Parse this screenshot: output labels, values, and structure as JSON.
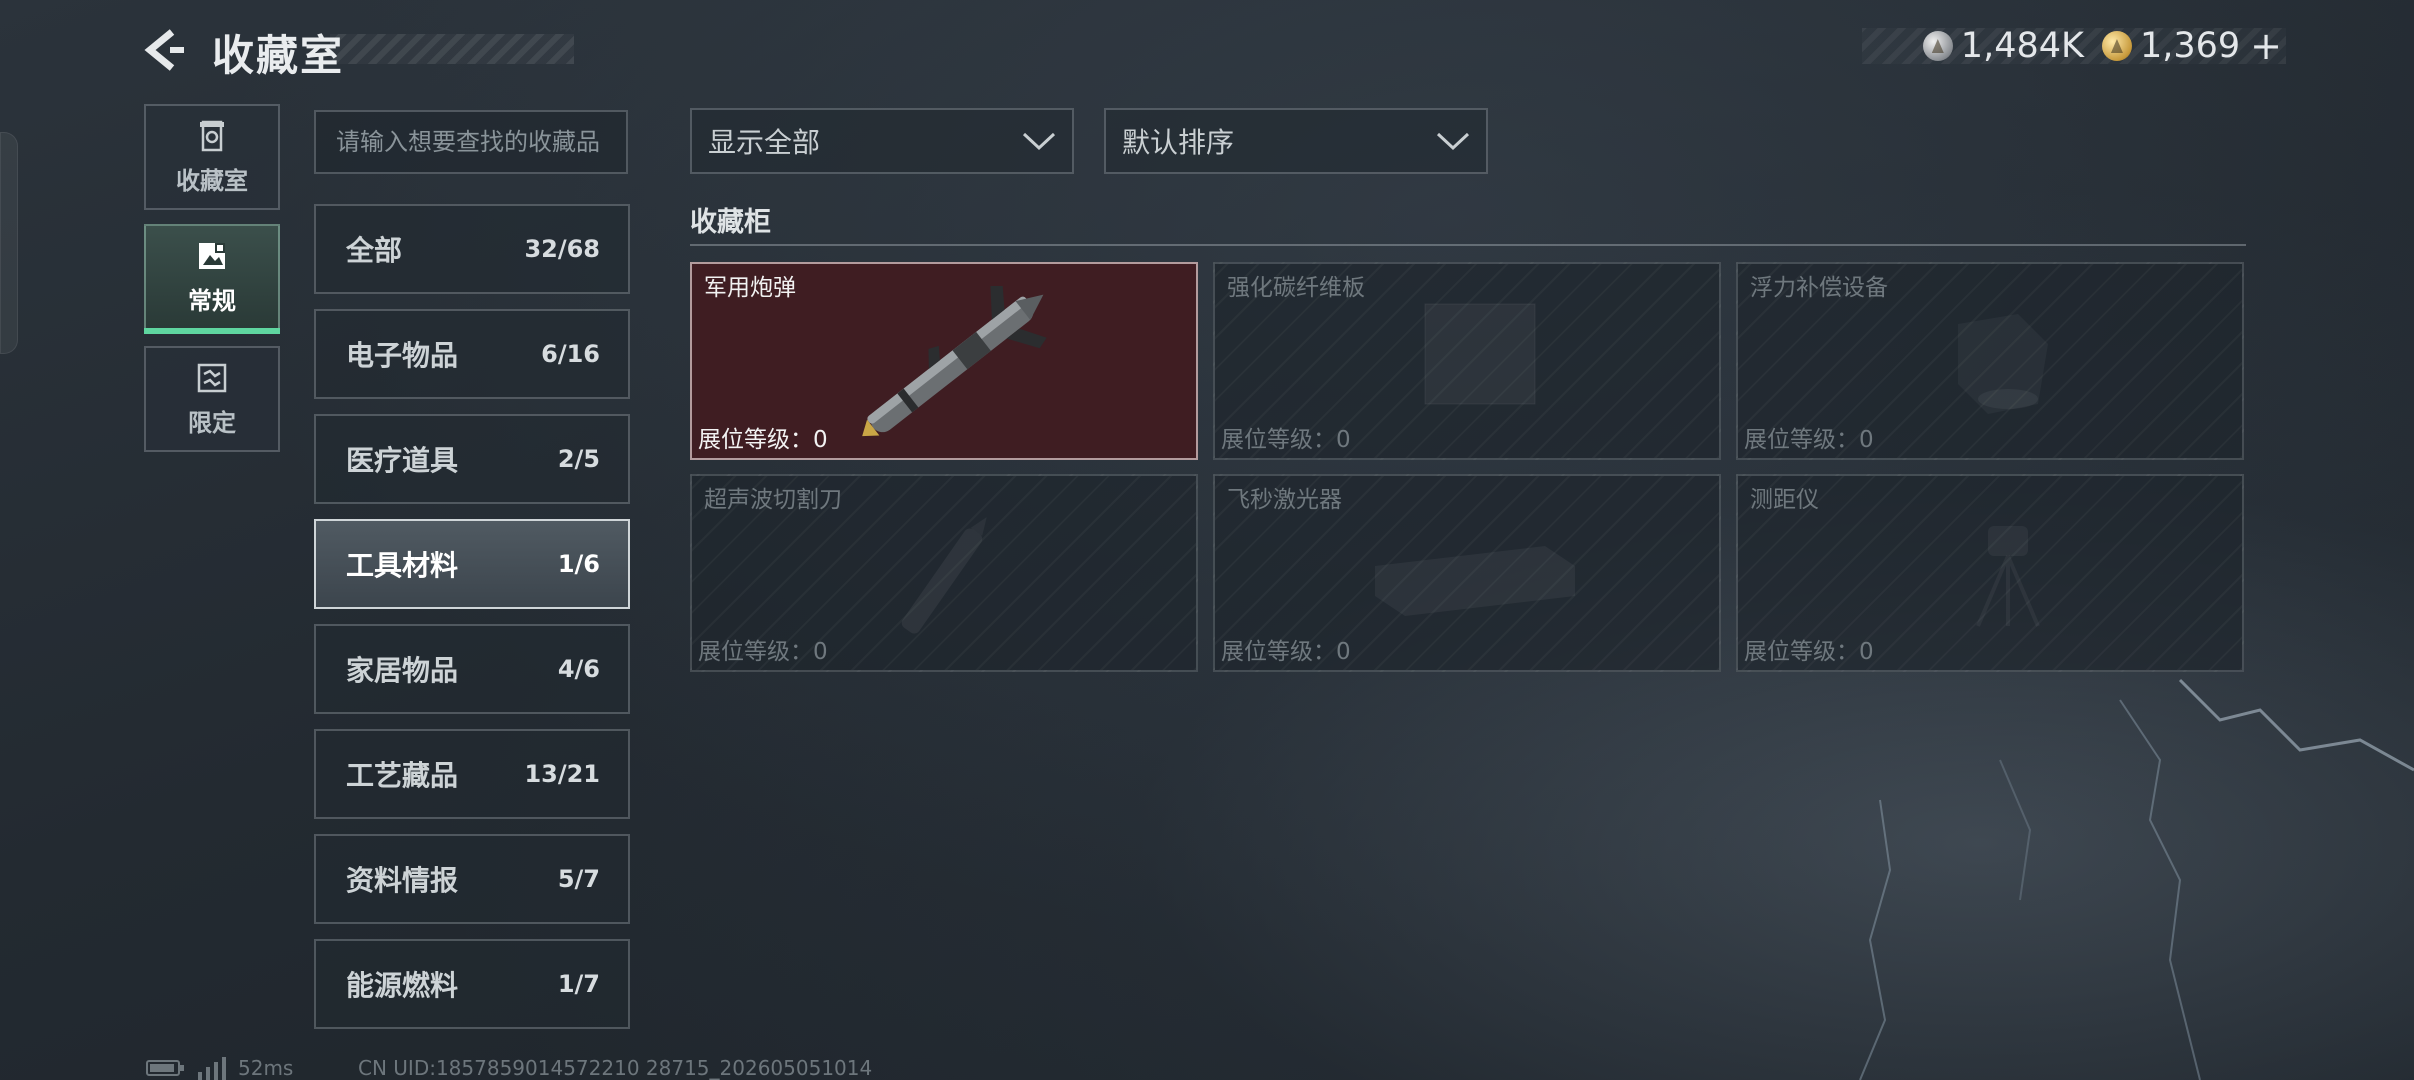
{
  "header": {
    "title": "收藏室",
    "currencies": [
      {
        "icon": "silver-coin-icon",
        "value": "1,484K"
      },
      {
        "icon": "gold-coin-icon",
        "value": "1,369"
      }
    ],
    "add_label": "+"
  },
  "side_nav": [
    {
      "label": "收藏室",
      "icon": "collection-room-icon",
      "active": false
    },
    {
      "label": "常规",
      "icon": "regular-icon",
      "active": true
    },
    {
      "label": "限定",
      "icon": "limited-icon",
      "active": false
    }
  ],
  "search": {
    "placeholder": "请输入想要查找的收藏品",
    "value": ""
  },
  "categories": [
    {
      "name": "全部",
      "count": "32/68",
      "selected": false
    },
    {
      "name": "电子物品",
      "count": "6/16",
      "selected": false
    },
    {
      "name": "医疗道具",
      "count": "2/5",
      "selected": false
    },
    {
      "name": "工具材料",
      "count": "1/6",
      "selected": true
    },
    {
      "name": "家居物品",
      "count": "4/6",
      "selected": false
    },
    {
      "name": "工艺藏品",
      "count": "13/21",
      "selected": false
    },
    {
      "name": "资料情报",
      "count": "5/7",
      "selected": false
    },
    {
      "name": "能源燃料",
      "count": "1/7",
      "selected": false
    }
  ],
  "filters": {
    "display": "显示全部",
    "sort": "默认排序"
  },
  "section_title": "收藏柜",
  "items": [
    {
      "name": "军用炮弹",
      "level": "展位等级：0",
      "owned": true
    },
    {
      "name": "强化碳纤维板",
      "level": "展位等级：0",
      "owned": false
    },
    {
      "name": "浮力补偿设备",
      "level": "展位等级：0",
      "owned": false
    },
    {
      "name": "超声波切割刀",
      "level": "展位等级：0",
      "owned": false
    },
    {
      "name": "飞秒激光器",
      "level": "展位等级：0",
      "owned": false
    },
    {
      "name": "测距仪",
      "level": "展位等级：0",
      "owned": false
    }
  ],
  "footer": {
    "ping": "52ms",
    "uid": "CN UID:1857859014572210 28715_202605051014"
  },
  "colors": {
    "owned_card": "#3f1d22",
    "active_tab_accent": "#5fd6a0"
  }
}
